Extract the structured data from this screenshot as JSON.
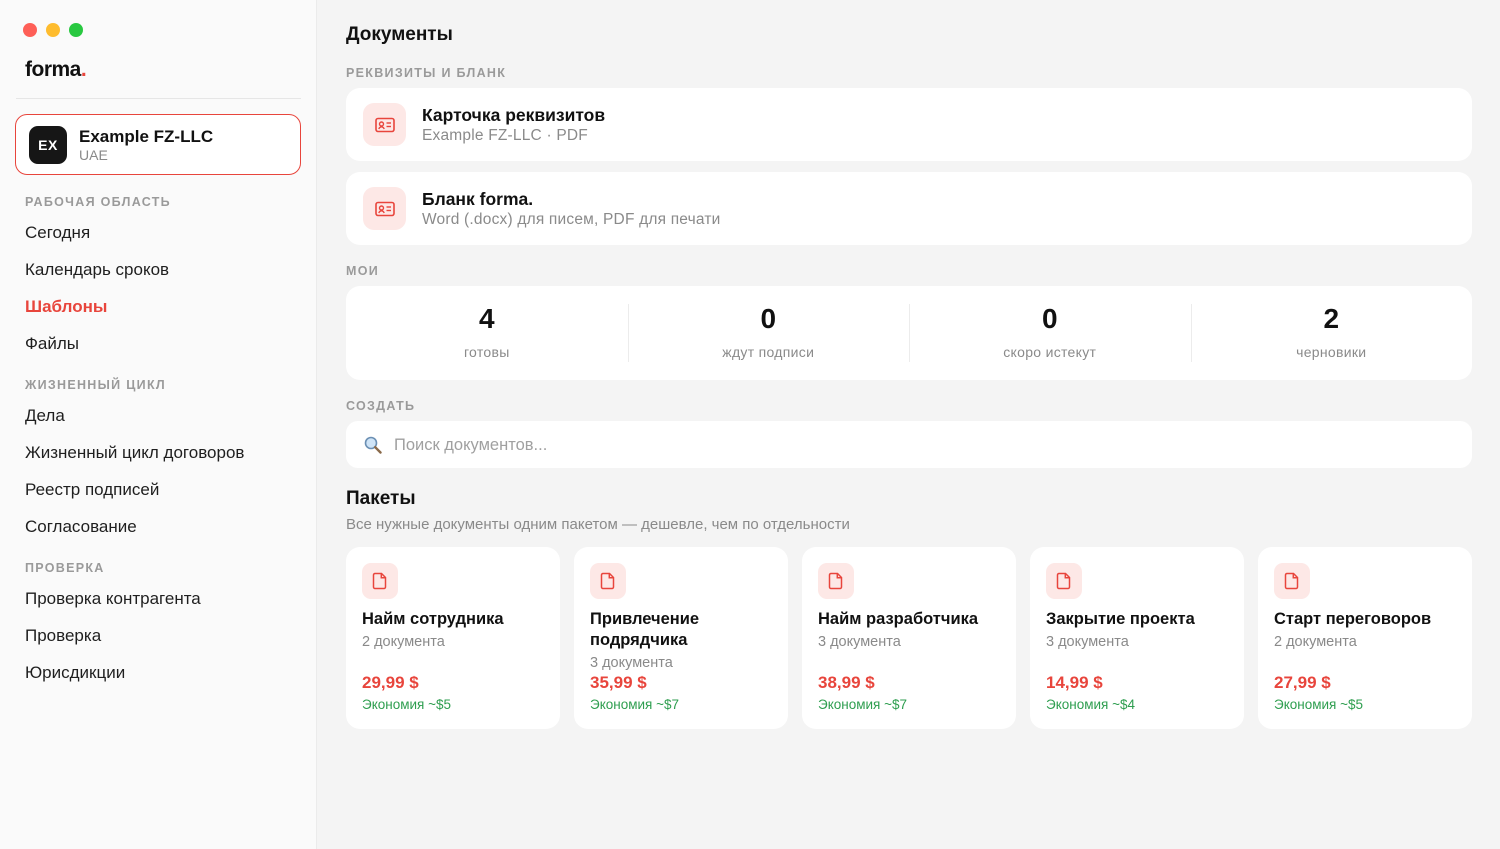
{
  "window": {
    "controls": [
      "close",
      "minimize",
      "maximize"
    ]
  },
  "brand": {
    "name": "forma",
    "dot": ".",
    "accent_color": "#e8453c"
  },
  "org": {
    "initials": "EX",
    "name": "Example FZ-LLC",
    "country": "UAE"
  },
  "sidebar": {
    "sections": [
      {
        "label": "РАБОЧАЯ ОБЛАСТЬ",
        "items": [
          {
            "label": "Сегодня",
            "active": false
          },
          {
            "label": "Календарь сроков",
            "active": false
          },
          {
            "label": "Шаблоны",
            "active": true
          },
          {
            "label": "Файлы",
            "active": false
          }
        ]
      },
      {
        "label": "ЖИЗНЕННЫЙ ЦИКЛ",
        "items": [
          {
            "label": "Дела",
            "active": false
          },
          {
            "label": "Жизненный цикл договоров",
            "active": false
          },
          {
            "label": "Реестр подписей",
            "active": false
          },
          {
            "label": "Согласование",
            "active": false
          }
        ]
      },
      {
        "label": "ПРОВЕРКА",
        "items": [
          {
            "label": "Проверка контрагента",
            "active": false
          },
          {
            "label": "Проверка",
            "active": false
          },
          {
            "label": "Юрисдикции",
            "active": false
          }
        ]
      }
    ]
  },
  "main": {
    "title": "Документы",
    "requisites": {
      "label": "РЕКВИЗИТЫ И БЛАНК",
      "cards": [
        {
          "icon": "id-card-icon",
          "title": "Карточка реквизитов",
          "subtitle": "Example FZ-LLC · PDF"
        },
        {
          "icon": "id-card-icon",
          "title": "Бланк forma.",
          "subtitle": "Word (.docx) для писем, PDF для печати"
        }
      ]
    },
    "mine": {
      "label": "МОИ",
      "stats": [
        {
          "value": "4",
          "label": "готовы"
        },
        {
          "value": "0",
          "label": "ждут подписи"
        },
        {
          "value": "0",
          "label": "скоро истекут"
        },
        {
          "value": "2",
          "label": "черновики"
        }
      ]
    },
    "create": {
      "label": "СОЗДАТЬ",
      "search_placeholder": "Поиск документов...",
      "search_value": ""
    },
    "packages": {
      "title": "Пакеты",
      "subtitle": "Все нужные документы одним пакетом — дешевле, чем по отдельности",
      "items": [
        {
          "name": "Найм сотрудника",
          "count": "2 документа",
          "price": "29,99 $",
          "savings": "Экономия ~$5"
        },
        {
          "name": "Привлечение подрядчика",
          "count": "3 документа",
          "price": "35,99 $",
          "savings": "Экономия ~$7"
        },
        {
          "name": "Найм разработчика",
          "count": "3 документа",
          "price": "38,99 $",
          "savings": "Экономия ~$7"
        },
        {
          "name": "Закрытие проекта",
          "count": "3 документа",
          "price": "14,99 $",
          "savings": "Экономия ~$4"
        },
        {
          "name": "Старт переговоров",
          "count": "2 документа",
          "price": "27,99 $",
          "savings": "Экономия ~$5"
        }
      ]
    }
  }
}
